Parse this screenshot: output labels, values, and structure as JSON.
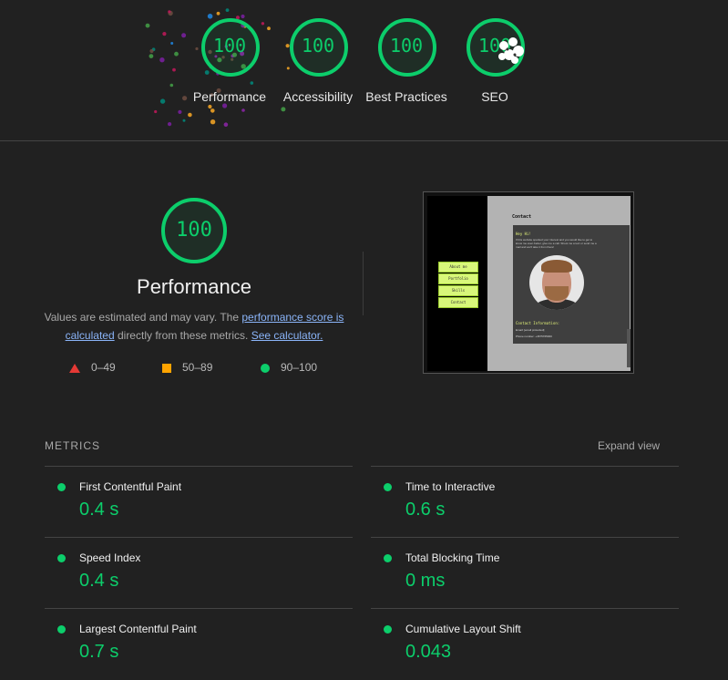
{
  "gauges": [
    {
      "label": "Performance",
      "score": "100"
    },
    {
      "label": "Accessibility",
      "score": "100"
    },
    {
      "label": "Best Practices",
      "score": "100"
    },
    {
      "label": "SEO",
      "score": "100"
    }
  ],
  "performance": {
    "score": "100",
    "title": "Performance",
    "desc_prefix": "Values are estimated and may vary. The ",
    "link_score": "performance score is calculated",
    "desc_middle": " directly from these metrics. ",
    "link_calc": "See calculator.",
    "legend": [
      {
        "range": "0–49",
        "icon": "red-triangle-icon",
        "color": "#e53935"
      },
      {
        "range": "50–89",
        "icon": "orange-square-icon",
        "color": "#ffa400"
      },
      {
        "range": "90–100",
        "icon": "green-circle-icon",
        "color": "#0cce6b"
      }
    ]
  },
  "screenshot": {
    "nav": [
      "About me",
      "Portfolio",
      "Skills",
      "Contact"
    ],
    "title": "Contact",
    "greeting": "Hey Hi!",
    "body": "If this website sparked your interest and you would like to get to know me even better, give me a call. Shoot me a text or send me a mail and we'll take it from there!",
    "info_label": "Contact Information:",
    "email": "Email: [email protected]",
    "phone": "Phone number: +4675765000"
  },
  "metrics": {
    "label": "METRICS",
    "expand": "Expand view",
    "items": [
      {
        "name": "First Contentful Paint",
        "value": "0.4 s"
      },
      {
        "name": "Time to Interactive",
        "value": "0.6 s"
      },
      {
        "name": "Speed Index",
        "value": "0.4 s"
      },
      {
        "name": "Total Blocking Time",
        "value": "0 ms"
      },
      {
        "name": "Largest Contentful Paint",
        "value": "0.7 s"
      },
      {
        "name": "Cumulative Layout Shift",
        "value": "0.043"
      }
    ]
  },
  "colors": {
    "pass": "#0cce6b",
    "background": "#212121"
  }
}
